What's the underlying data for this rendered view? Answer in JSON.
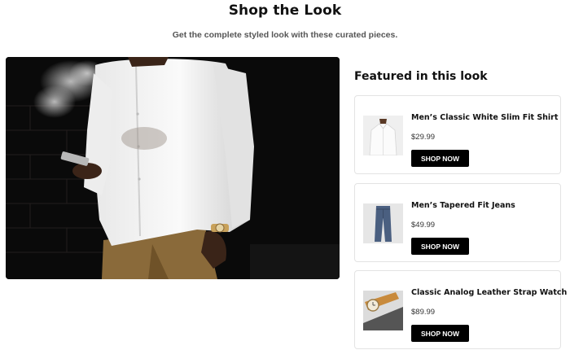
{
  "header": {
    "title": "Shop the Look",
    "subtitle": "Get the complete styled look with these curated pieces."
  },
  "hero": {
    "image_icon": "model-photo"
  },
  "featured": {
    "heading": "Featured in this look",
    "products": [
      {
        "name": "Men’s Classic White Slim Fit Shirt",
        "price": "$29.99",
        "button": "SHOP NOW",
        "thumb_icon": "shirt-thumbnail"
      },
      {
        "name": "Men’s Tapered Fit Jeans",
        "price": "$49.99",
        "button": "SHOP NOW",
        "thumb_icon": "jeans-thumbnail"
      },
      {
        "name": "Classic Analog Leather Strap Watch",
        "price": "$89.99",
        "button": "SHOP NOW",
        "thumb_icon": "watch-thumbnail"
      }
    ]
  },
  "colors": {
    "button_bg": "#000000",
    "button_text": "#ffffff",
    "card_border": "#e3e3e3"
  }
}
